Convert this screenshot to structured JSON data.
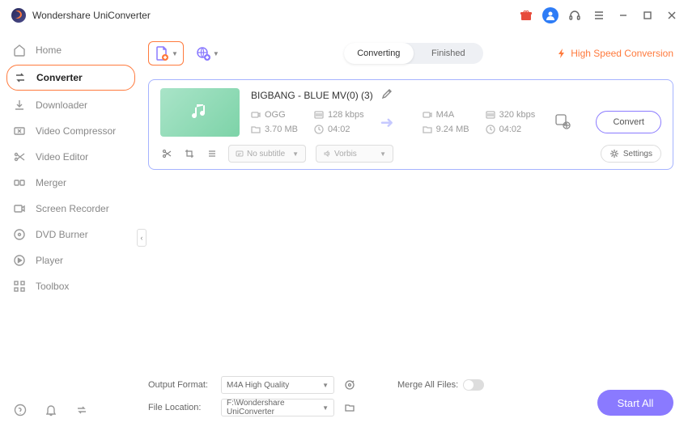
{
  "app": {
    "title": "Wondershare UniConverter"
  },
  "sidebar": {
    "items": [
      {
        "label": "Home"
      },
      {
        "label": "Converter"
      },
      {
        "label": "Downloader"
      },
      {
        "label": "Video Compressor"
      },
      {
        "label": "Video Editor"
      },
      {
        "label": "Merger"
      },
      {
        "label": "Screen Recorder"
      },
      {
        "label": "DVD Burner"
      },
      {
        "label": "Player"
      },
      {
        "label": "Toolbox"
      }
    ]
  },
  "toolbar": {
    "tabs": {
      "converting": "Converting",
      "finished": "Finished"
    },
    "high_speed": "High Speed Conversion"
  },
  "file": {
    "name": "BIGBANG - BLUE MV(0) (3)",
    "src": {
      "format": "OGG",
      "bitrate": "128 kbps",
      "size": "3.70 MB",
      "duration": "04:02"
    },
    "dst": {
      "format": "M4A",
      "bitrate": "320 kbps",
      "size": "9.24 MB",
      "duration": "04:02"
    },
    "subtitle": "No subtitle",
    "audio_codec": "Vorbis",
    "settings_label": "Settings",
    "convert_label": "Convert"
  },
  "footer": {
    "output_format_label": "Output Format:",
    "output_format_value": "M4A High Quality",
    "file_location_label": "File Location:",
    "file_location_value": "F:\\Wondershare UniConverter",
    "merge_label": "Merge All Files:",
    "start_all": "Start All"
  }
}
